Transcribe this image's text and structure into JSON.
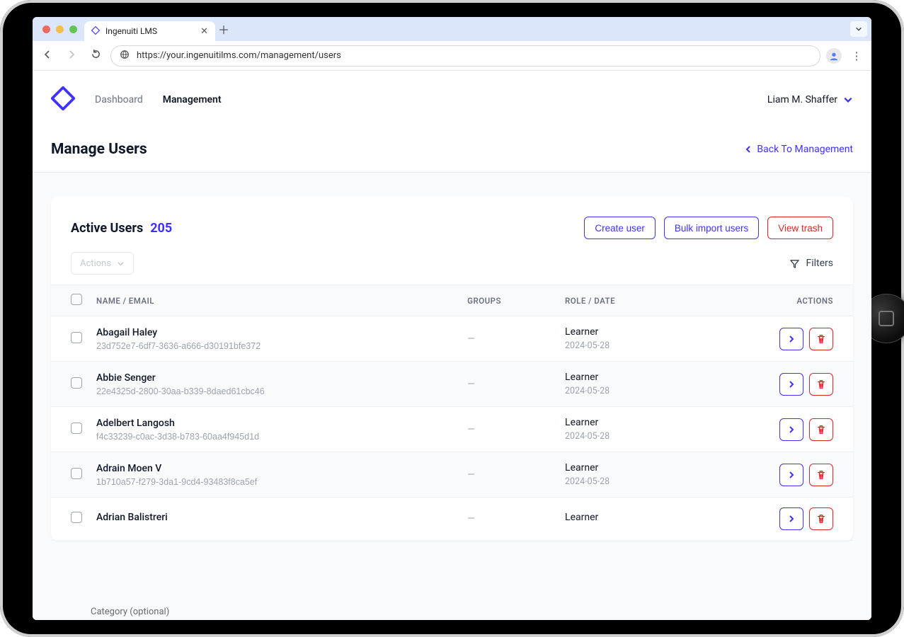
{
  "browser": {
    "tab_title": "Ingenuiti LMS",
    "url": "https://your.ingenuitilms.com/management/users"
  },
  "header": {
    "nav": {
      "dashboard": "Dashboard",
      "management": "Management"
    },
    "user_name": "Liam M. Shaffer"
  },
  "pagebar": {
    "title": "Manage Users",
    "back": "Back To Management"
  },
  "panel": {
    "title": "Active Users",
    "count": "205",
    "create": "Create user",
    "bulk": "Bulk import users",
    "trash": "View trash",
    "actions_label": "Actions",
    "filters_label": "Filters"
  },
  "table": {
    "head": {
      "name": "NAME / EMAIL",
      "groups": "GROUPS",
      "role": "ROLE / DATE",
      "actions": "ACTIONS"
    },
    "rows": [
      {
        "name": "Abagail Haley",
        "id": "23d752e7-6df7-3636-a666-d30191bfe372",
        "groups": "—",
        "role": "Learner",
        "date": "2024-05-28"
      },
      {
        "name": "Abbie Senger",
        "id": "22e4325d-2800-30aa-b339-8daed61cbc46",
        "groups": "—",
        "role": "Learner",
        "date": "2024-05-28"
      },
      {
        "name": "Adelbert Langosh",
        "id": "f4c33239-c0ac-3d38-b783-60aa4f945d1d",
        "groups": "—",
        "role": "Learner",
        "date": "2024-05-28"
      },
      {
        "name": "Adrain Moen V",
        "id": "1b710a57-f279-3da1-9cd4-93483f8ca5ef",
        "groups": "—",
        "role": "Learner",
        "date": "2024-05-28"
      },
      {
        "name": "Adrian Balistreri",
        "id": "",
        "groups": "—",
        "role": "Learner",
        "date": ""
      }
    ]
  },
  "ghost_text": "Category (optional)"
}
